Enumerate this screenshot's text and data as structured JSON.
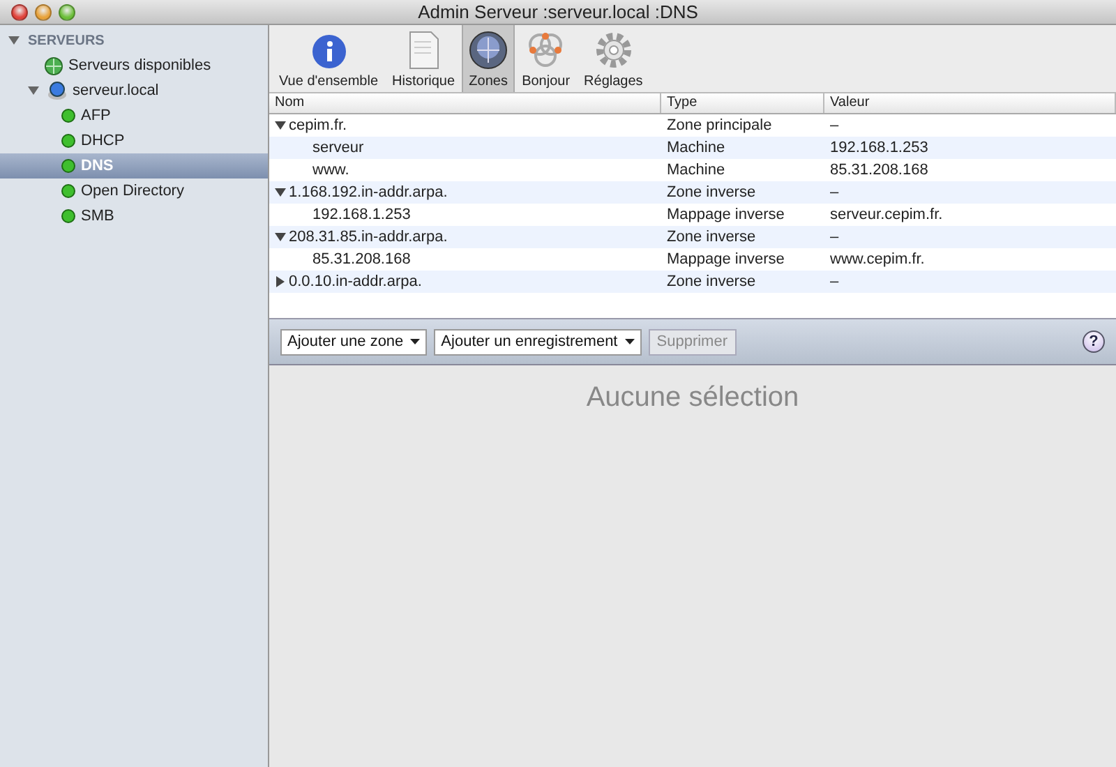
{
  "window": {
    "title": "Admin Serveur :serveur.local :DNS"
  },
  "sidebar": {
    "heading": "SERVEURS",
    "expanded": true,
    "items": [
      {
        "label": "Serveurs disponibles",
        "kind": "globe",
        "selected": false
      },
      {
        "label": "serveur.local",
        "kind": "server",
        "selected": false,
        "expanded": true,
        "children": [
          {
            "label": "AFP",
            "kind": "service",
            "selected": false
          },
          {
            "label": "DHCP",
            "kind": "service",
            "selected": false
          },
          {
            "label": "DNS",
            "kind": "service",
            "selected": true
          },
          {
            "label": "Open Directory",
            "kind": "service",
            "selected": false
          },
          {
            "label": "SMB",
            "kind": "service",
            "selected": false
          }
        ]
      }
    ]
  },
  "toolbar": [
    {
      "label": "Vue d'ensemble",
      "kind": "info",
      "selected": false
    },
    {
      "label": "Historique",
      "kind": "log",
      "selected": false
    },
    {
      "label": "Zones",
      "kind": "zones",
      "selected": true
    },
    {
      "label": "Bonjour",
      "kind": "bonjour",
      "selected": false
    },
    {
      "label": "Réglages",
      "kind": "gear",
      "selected": false
    }
  ],
  "table": {
    "columns": [
      "Nom",
      "Type",
      "Valeur"
    ],
    "rows": [
      {
        "name": "cepim.fr.",
        "type": "Zone principale",
        "value": "–",
        "expanded": true,
        "children": [
          {
            "name": "serveur",
            "type": "Machine",
            "value": "192.168.1.253"
          },
          {
            "name": "www.",
            "type": "Machine",
            "value": "85.31.208.168"
          }
        ]
      },
      {
        "name": "1.168.192.in-addr.arpa.",
        "type": "Zone inverse",
        "value": "–",
        "expanded": true,
        "children": [
          {
            "name": "192.168.1.253",
            "type": "Mappage inverse",
            "value": "serveur.cepim.fr."
          }
        ]
      },
      {
        "name": "208.31.85.in-addr.arpa.",
        "type": "Zone inverse",
        "value": "–",
        "expanded": true,
        "children": [
          {
            "name": "85.31.208.168",
            "type": "Mappage inverse",
            "value": "www.cepim.fr."
          }
        ]
      },
      {
        "name": "0.0.10.in-addr.arpa.",
        "type": "Zone inverse",
        "value": "–",
        "expanded": false
      }
    ]
  },
  "actions": [
    {
      "label": "Ajouter une zone",
      "kind": "dropdown"
    },
    {
      "label": "Ajouter un enregistrement",
      "kind": "dropdown"
    },
    {
      "label": "Supprimer",
      "kind": "button",
      "disabled": true
    }
  ],
  "help": "?",
  "detail": {
    "message": "Aucune sélection"
  }
}
